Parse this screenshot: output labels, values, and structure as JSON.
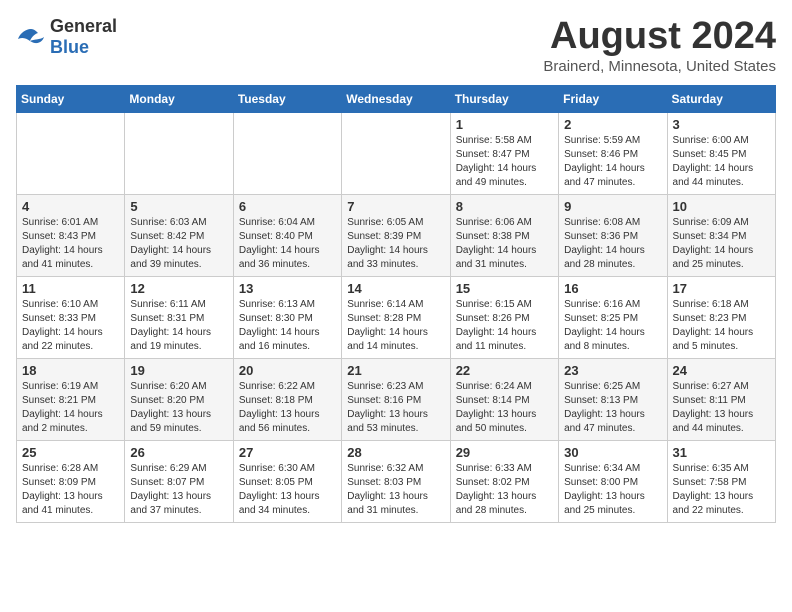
{
  "logo": {
    "general": "General",
    "blue": "Blue"
  },
  "title": "August 2024",
  "subtitle": "Brainerd, Minnesota, United States",
  "days_of_week": [
    "Sunday",
    "Monday",
    "Tuesday",
    "Wednesday",
    "Thursday",
    "Friday",
    "Saturday"
  ],
  "weeks": [
    [
      {
        "day": "",
        "info": ""
      },
      {
        "day": "",
        "info": ""
      },
      {
        "day": "",
        "info": ""
      },
      {
        "day": "",
        "info": ""
      },
      {
        "day": "1",
        "info": "Sunrise: 5:58 AM\nSunset: 8:47 PM\nDaylight: 14 hours\nand 49 minutes."
      },
      {
        "day": "2",
        "info": "Sunrise: 5:59 AM\nSunset: 8:46 PM\nDaylight: 14 hours\nand 47 minutes."
      },
      {
        "day": "3",
        "info": "Sunrise: 6:00 AM\nSunset: 8:45 PM\nDaylight: 14 hours\nand 44 minutes."
      }
    ],
    [
      {
        "day": "4",
        "info": "Sunrise: 6:01 AM\nSunset: 8:43 PM\nDaylight: 14 hours\nand 41 minutes."
      },
      {
        "day": "5",
        "info": "Sunrise: 6:03 AM\nSunset: 8:42 PM\nDaylight: 14 hours\nand 39 minutes."
      },
      {
        "day": "6",
        "info": "Sunrise: 6:04 AM\nSunset: 8:40 PM\nDaylight: 14 hours\nand 36 minutes."
      },
      {
        "day": "7",
        "info": "Sunrise: 6:05 AM\nSunset: 8:39 PM\nDaylight: 14 hours\nand 33 minutes."
      },
      {
        "day": "8",
        "info": "Sunrise: 6:06 AM\nSunset: 8:38 PM\nDaylight: 14 hours\nand 31 minutes."
      },
      {
        "day": "9",
        "info": "Sunrise: 6:08 AM\nSunset: 8:36 PM\nDaylight: 14 hours\nand 28 minutes."
      },
      {
        "day": "10",
        "info": "Sunrise: 6:09 AM\nSunset: 8:34 PM\nDaylight: 14 hours\nand 25 minutes."
      }
    ],
    [
      {
        "day": "11",
        "info": "Sunrise: 6:10 AM\nSunset: 8:33 PM\nDaylight: 14 hours\nand 22 minutes."
      },
      {
        "day": "12",
        "info": "Sunrise: 6:11 AM\nSunset: 8:31 PM\nDaylight: 14 hours\nand 19 minutes."
      },
      {
        "day": "13",
        "info": "Sunrise: 6:13 AM\nSunset: 8:30 PM\nDaylight: 14 hours\nand 16 minutes."
      },
      {
        "day": "14",
        "info": "Sunrise: 6:14 AM\nSunset: 8:28 PM\nDaylight: 14 hours\nand 14 minutes."
      },
      {
        "day": "15",
        "info": "Sunrise: 6:15 AM\nSunset: 8:26 PM\nDaylight: 14 hours\nand 11 minutes."
      },
      {
        "day": "16",
        "info": "Sunrise: 6:16 AM\nSunset: 8:25 PM\nDaylight: 14 hours\nand 8 minutes."
      },
      {
        "day": "17",
        "info": "Sunrise: 6:18 AM\nSunset: 8:23 PM\nDaylight: 14 hours\nand 5 minutes."
      }
    ],
    [
      {
        "day": "18",
        "info": "Sunrise: 6:19 AM\nSunset: 8:21 PM\nDaylight: 14 hours\nand 2 minutes."
      },
      {
        "day": "19",
        "info": "Sunrise: 6:20 AM\nSunset: 8:20 PM\nDaylight: 13 hours\nand 59 minutes."
      },
      {
        "day": "20",
        "info": "Sunrise: 6:22 AM\nSunset: 8:18 PM\nDaylight: 13 hours\nand 56 minutes."
      },
      {
        "day": "21",
        "info": "Sunrise: 6:23 AM\nSunset: 8:16 PM\nDaylight: 13 hours\nand 53 minutes."
      },
      {
        "day": "22",
        "info": "Sunrise: 6:24 AM\nSunset: 8:14 PM\nDaylight: 13 hours\nand 50 minutes."
      },
      {
        "day": "23",
        "info": "Sunrise: 6:25 AM\nSunset: 8:13 PM\nDaylight: 13 hours\nand 47 minutes."
      },
      {
        "day": "24",
        "info": "Sunrise: 6:27 AM\nSunset: 8:11 PM\nDaylight: 13 hours\nand 44 minutes."
      }
    ],
    [
      {
        "day": "25",
        "info": "Sunrise: 6:28 AM\nSunset: 8:09 PM\nDaylight: 13 hours\nand 41 minutes."
      },
      {
        "day": "26",
        "info": "Sunrise: 6:29 AM\nSunset: 8:07 PM\nDaylight: 13 hours\nand 37 minutes."
      },
      {
        "day": "27",
        "info": "Sunrise: 6:30 AM\nSunset: 8:05 PM\nDaylight: 13 hours\nand 34 minutes."
      },
      {
        "day": "28",
        "info": "Sunrise: 6:32 AM\nSunset: 8:03 PM\nDaylight: 13 hours\nand 31 minutes."
      },
      {
        "day": "29",
        "info": "Sunrise: 6:33 AM\nSunset: 8:02 PM\nDaylight: 13 hours\nand 28 minutes."
      },
      {
        "day": "30",
        "info": "Sunrise: 6:34 AM\nSunset: 8:00 PM\nDaylight: 13 hours\nand 25 minutes."
      },
      {
        "day": "31",
        "info": "Sunrise: 6:35 AM\nSunset: 7:58 PM\nDaylight: 13 hours\nand 22 minutes."
      }
    ]
  ]
}
